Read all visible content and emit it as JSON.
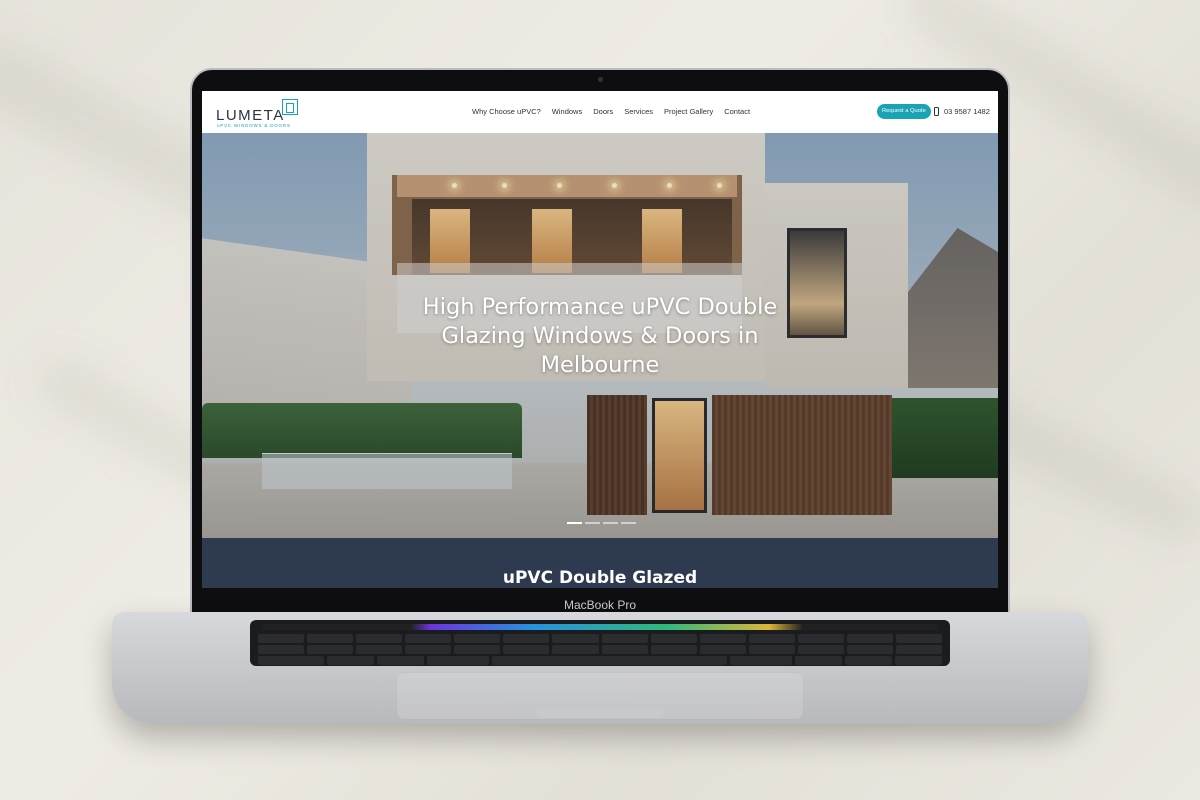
{
  "device": {
    "label": "MacBook Pro"
  },
  "site": {
    "logo": {
      "name": "LUMETA",
      "tagline": "uPVC WINDOWS & DOORS"
    },
    "nav": [
      {
        "label": "Why Choose uPVC?"
      },
      {
        "label": "Windows"
      },
      {
        "label": "Doors"
      },
      {
        "label": "Services"
      },
      {
        "label": "Project Gallery"
      },
      {
        "label": "Contact"
      }
    ],
    "cta_label": "Request a Quote",
    "phone": "03 9587 1482",
    "brand_color": "#1aa3b3",
    "hero": {
      "title": "High Performance uPVC Double Glazing Windows & Doors in Melbourne",
      "slides": 4,
      "active_slide": 1
    },
    "section": {
      "title": "uPVC Double Glazed",
      "background": "#2e3a4f"
    }
  },
  "icons": [
    "logo-mark-icon",
    "phone-icon"
  ]
}
